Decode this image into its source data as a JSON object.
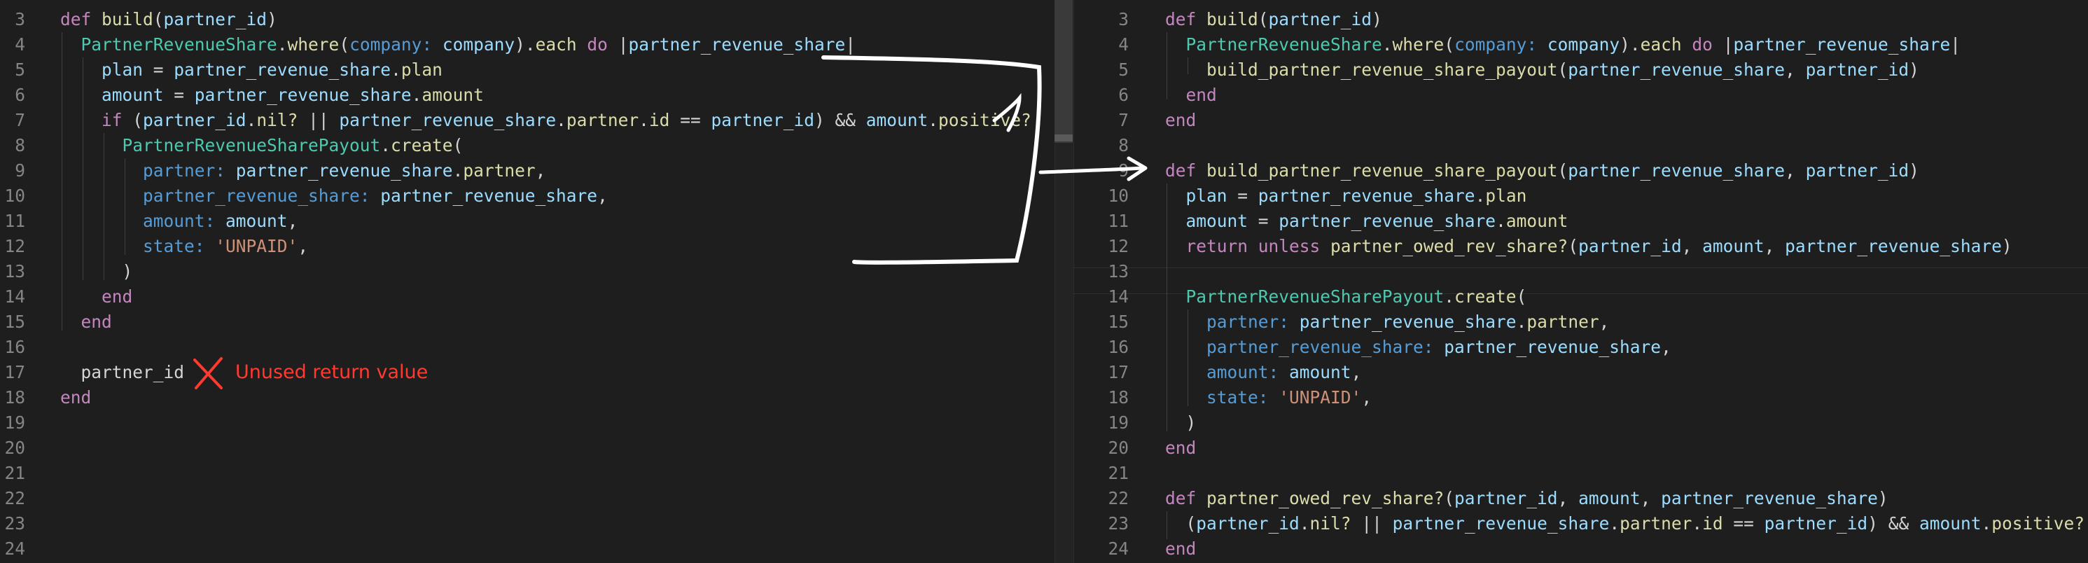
{
  "left": {
    "lines": [
      {
        "n": "3",
        "tokens": [
          [
            "kw",
            "def "
          ],
          [
            "fn",
            "build"
          ],
          [
            "txt",
            "("
          ],
          [
            "var",
            "partner_id"
          ],
          [
            "txt",
            ")"
          ]
        ]
      },
      {
        "n": "4",
        "tokens": [
          [
            "txt",
            "  "
          ],
          [
            "cls",
            "PartnerRevenueShare"
          ],
          [
            "txt",
            "."
          ],
          [
            "fn",
            "where"
          ],
          [
            "txt",
            "("
          ],
          [
            "sym",
            "company:"
          ],
          [
            "txt",
            " "
          ],
          [
            "var",
            "company"
          ],
          [
            "txt",
            ")."
          ],
          [
            "fn",
            "each"
          ],
          [
            "txt",
            " "
          ],
          [
            "kw",
            "do"
          ],
          [
            "txt",
            " |"
          ],
          [
            "var",
            "partner_revenue_share"
          ],
          [
            "txt",
            "|"
          ]
        ]
      },
      {
        "n": "5",
        "tokens": [
          [
            "txt",
            "    "
          ],
          [
            "var",
            "plan"
          ],
          [
            "txt",
            " = "
          ],
          [
            "var",
            "partner_revenue_share"
          ],
          [
            "txt",
            "."
          ],
          [
            "fn",
            "plan"
          ]
        ]
      },
      {
        "n": "6",
        "tokens": [
          [
            "txt",
            "    "
          ],
          [
            "var",
            "amount"
          ],
          [
            "txt",
            " = "
          ],
          [
            "var",
            "partner_revenue_share"
          ],
          [
            "txt",
            "."
          ],
          [
            "fn",
            "amount"
          ]
        ]
      },
      {
        "n": "7",
        "tokens": [
          [
            "txt",
            "    "
          ],
          [
            "kw",
            "if"
          ],
          [
            "txt",
            " ("
          ],
          [
            "var",
            "partner_id"
          ],
          [
            "txt",
            "."
          ],
          [
            "fn",
            "nil?"
          ],
          [
            "txt",
            " || "
          ],
          [
            "var",
            "partner_revenue_share"
          ],
          [
            "txt",
            "."
          ],
          [
            "fn",
            "partner"
          ],
          [
            "txt",
            "."
          ],
          [
            "fn",
            "id"
          ],
          [
            "txt",
            " == "
          ],
          [
            "var",
            "partner_id"
          ],
          [
            "txt",
            ") && "
          ],
          [
            "var",
            "amount"
          ],
          [
            "txt",
            "."
          ],
          [
            "fn",
            "positive?"
          ]
        ]
      },
      {
        "n": "8",
        "tokens": [
          [
            "txt",
            "      "
          ],
          [
            "cls",
            "PartnerRevenueSharePayout"
          ],
          [
            "txt",
            "."
          ],
          [
            "fn",
            "create"
          ],
          [
            "txt",
            "("
          ]
        ]
      },
      {
        "n": "9",
        "tokens": [
          [
            "txt",
            "        "
          ],
          [
            "sym",
            "partner:"
          ],
          [
            "txt",
            " "
          ],
          [
            "var",
            "partner_revenue_share"
          ],
          [
            "txt",
            "."
          ],
          [
            "fn",
            "partner"
          ],
          [
            "txt",
            ","
          ]
        ]
      },
      {
        "n": "10",
        "tokens": [
          [
            "txt",
            "        "
          ],
          [
            "sym",
            "partner_revenue_share:"
          ],
          [
            "txt",
            " "
          ],
          [
            "var",
            "partner_revenue_share"
          ],
          [
            "txt",
            ","
          ]
        ]
      },
      {
        "n": "11",
        "tokens": [
          [
            "txt",
            "        "
          ],
          [
            "sym",
            "amount:"
          ],
          [
            "txt",
            " "
          ],
          [
            "var",
            "amount"
          ],
          [
            "txt",
            ","
          ]
        ]
      },
      {
        "n": "12",
        "tokens": [
          [
            "txt",
            "        "
          ],
          [
            "sym",
            "state:"
          ],
          [
            "txt",
            " "
          ],
          [
            "str",
            "'UNPAID'"
          ],
          [
            "txt",
            ","
          ]
        ]
      },
      {
        "n": "13",
        "tokens": [
          [
            "txt",
            "      )"
          ]
        ]
      },
      {
        "n": "14",
        "tokens": [
          [
            "txt",
            "    "
          ],
          [
            "kw",
            "end"
          ]
        ]
      },
      {
        "n": "15",
        "tokens": [
          [
            "txt",
            "  "
          ],
          [
            "kw",
            "end"
          ]
        ]
      },
      {
        "n": "16",
        "tokens": []
      },
      {
        "n": "17",
        "tokens": [
          [
            "txt",
            "  "
          ],
          [
            "txt",
            "partner_id"
          ]
        ]
      },
      {
        "n": "18",
        "tokens": [
          [
            "kw",
            "end"
          ]
        ]
      },
      {
        "n": "19",
        "tokens": []
      },
      {
        "n": "20",
        "tokens": []
      },
      {
        "n": "21",
        "tokens": []
      },
      {
        "n": "22",
        "tokens": []
      },
      {
        "n": "23",
        "tokens": []
      },
      {
        "n": "24",
        "tokens": []
      }
    ],
    "annotation": "Unused return value"
  },
  "right": {
    "lines": [
      {
        "n": "3",
        "tokens": [
          [
            "kw",
            "def "
          ],
          [
            "fn",
            "build"
          ],
          [
            "txt",
            "("
          ],
          [
            "var",
            "partner_id"
          ],
          [
            "txt",
            ")"
          ]
        ]
      },
      {
        "n": "4",
        "tokens": [
          [
            "txt",
            "  "
          ],
          [
            "cls",
            "PartnerRevenueShare"
          ],
          [
            "txt",
            "."
          ],
          [
            "fn",
            "where"
          ],
          [
            "txt",
            "("
          ],
          [
            "sym",
            "company:"
          ],
          [
            "txt",
            " "
          ],
          [
            "var",
            "company"
          ],
          [
            "txt",
            ")."
          ],
          [
            "fn",
            "each"
          ],
          [
            "txt",
            " "
          ],
          [
            "kw",
            "do"
          ],
          [
            "txt",
            " |"
          ],
          [
            "var",
            "partner_revenue_share"
          ],
          [
            "txt",
            "|"
          ]
        ]
      },
      {
        "n": "5",
        "tokens": [
          [
            "txt",
            "    "
          ],
          [
            "fn",
            "build_partner_revenue_share_payout"
          ],
          [
            "txt",
            "("
          ],
          [
            "var",
            "partner_revenue_share"
          ],
          [
            "txt",
            ", "
          ],
          [
            "var",
            "partner_id"
          ],
          [
            "txt",
            ")"
          ]
        ]
      },
      {
        "n": "6",
        "tokens": [
          [
            "txt",
            "  "
          ],
          [
            "kw",
            "end"
          ]
        ]
      },
      {
        "n": "7",
        "tokens": [
          [
            "kw",
            "end"
          ]
        ]
      },
      {
        "n": "8",
        "tokens": []
      },
      {
        "n": "9",
        "tokens": [
          [
            "kw",
            "def "
          ],
          [
            "fn",
            "build_partner_revenue_share_payout"
          ],
          [
            "txt",
            "("
          ],
          [
            "var",
            "partner_revenue_share"
          ],
          [
            "txt",
            ", "
          ],
          [
            "var",
            "partner_id"
          ],
          [
            "txt",
            ")"
          ]
        ]
      },
      {
        "n": "10",
        "tokens": [
          [
            "txt",
            "  "
          ],
          [
            "var",
            "plan"
          ],
          [
            "txt",
            " = "
          ],
          [
            "var",
            "partner_revenue_share"
          ],
          [
            "txt",
            "."
          ],
          [
            "fn",
            "plan"
          ]
        ]
      },
      {
        "n": "11",
        "tokens": [
          [
            "txt",
            "  "
          ],
          [
            "var",
            "amount"
          ],
          [
            "txt",
            " = "
          ],
          [
            "var",
            "partner_revenue_share"
          ],
          [
            "txt",
            "."
          ],
          [
            "fn",
            "amount"
          ]
        ]
      },
      {
        "n": "12",
        "tokens": [
          [
            "txt",
            "  "
          ],
          [
            "kw",
            "return unless"
          ],
          [
            "txt",
            " "
          ],
          [
            "fn",
            "partner_owed_rev_share?"
          ],
          [
            "txt",
            "("
          ],
          [
            "var",
            "partner_id"
          ],
          [
            "txt",
            ", "
          ],
          [
            "var",
            "amount"
          ],
          [
            "txt",
            ", "
          ],
          [
            "var",
            "partner_revenue_share"
          ],
          [
            "txt",
            ")"
          ]
        ]
      },
      {
        "n": "13",
        "tokens": []
      },
      {
        "n": "14",
        "tokens": [
          [
            "txt",
            "  "
          ],
          [
            "cls",
            "PartnerRevenueSharePayout"
          ],
          [
            "txt",
            "."
          ],
          [
            "fn",
            "create"
          ],
          [
            "txt",
            "("
          ]
        ]
      },
      {
        "n": "15",
        "tokens": [
          [
            "txt",
            "    "
          ],
          [
            "sym",
            "partner:"
          ],
          [
            "txt",
            " "
          ],
          [
            "var",
            "partner_revenue_share"
          ],
          [
            "txt",
            "."
          ],
          [
            "fn",
            "partner"
          ],
          [
            "txt",
            ","
          ]
        ]
      },
      {
        "n": "16",
        "tokens": [
          [
            "txt",
            "    "
          ],
          [
            "sym",
            "partner_revenue_share:"
          ],
          [
            "txt",
            " "
          ],
          [
            "var",
            "partner_revenue_share"
          ],
          [
            "txt",
            ","
          ]
        ]
      },
      {
        "n": "17",
        "tokens": [
          [
            "txt",
            "    "
          ],
          [
            "sym",
            "amount:"
          ],
          [
            "txt",
            " "
          ],
          [
            "var",
            "amount"
          ],
          [
            "txt",
            ","
          ]
        ]
      },
      {
        "n": "18",
        "tokens": [
          [
            "txt",
            "    "
          ],
          [
            "sym",
            "state:"
          ],
          [
            "txt",
            " "
          ],
          [
            "str",
            "'UNPAID'"
          ],
          [
            "txt",
            ","
          ]
        ]
      },
      {
        "n": "19",
        "tokens": [
          [
            "txt",
            "  )"
          ]
        ]
      },
      {
        "n": "20",
        "tokens": [
          [
            "kw",
            "end"
          ]
        ]
      },
      {
        "n": "21",
        "tokens": []
      },
      {
        "n": "22",
        "tokens": [
          [
            "kw",
            "def "
          ],
          [
            "fn",
            "partner_owed_rev_share?"
          ],
          [
            "txt",
            "("
          ],
          [
            "var",
            "partner_id"
          ],
          [
            "txt",
            ", "
          ],
          [
            "var",
            "amount"
          ],
          [
            "txt",
            ", "
          ],
          [
            "var",
            "partner_revenue_share"
          ],
          [
            "txt",
            ")"
          ]
        ]
      },
      {
        "n": "23",
        "tokens": [
          [
            "txt",
            "  ("
          ],
          [
            "var",
            "partner_id"
          ],
          [
            "txt",
            "."
          ],
          [
            "fn",
            "nil?"
          ],
          [
            "txt",
            " || "
          ],
          [
            "var",
            "partner_revenue_share"
          ],
          [
            "txt",
            "."
          ],
          [
            "fn",
            "partner"
          ],
          [
            "txt",
            "."
          ],
          [
            "fn",
            "id"
          ],
          [
            "txt",
            " == "
          ],
          [
            "var",
            "partner_id"
          ],
          [
            "txt",
            ") && "
          ],
          [
            "var",
            "amount"
          ],
          [
            "txt",
            "."
          ],
          [
            "fn",
            "positive?"
          ]
        ]
      },
      {
        "n": "24",
        "tokens": [
          [
            "kw",
            "end"
          ]
        ]
      }
    ]
  },
  "colors": {
    "background": "#1e1e1e",
    "keyword": "#c586c0",
    "function": "#dcdcaa",
    "class": "#4ec9b0",
    "variable": "#9cdcfe",
    "symbol": "#569cd6",
    "string": "#ce9178",
    "annotation": "#ff3b30"
  }
}
